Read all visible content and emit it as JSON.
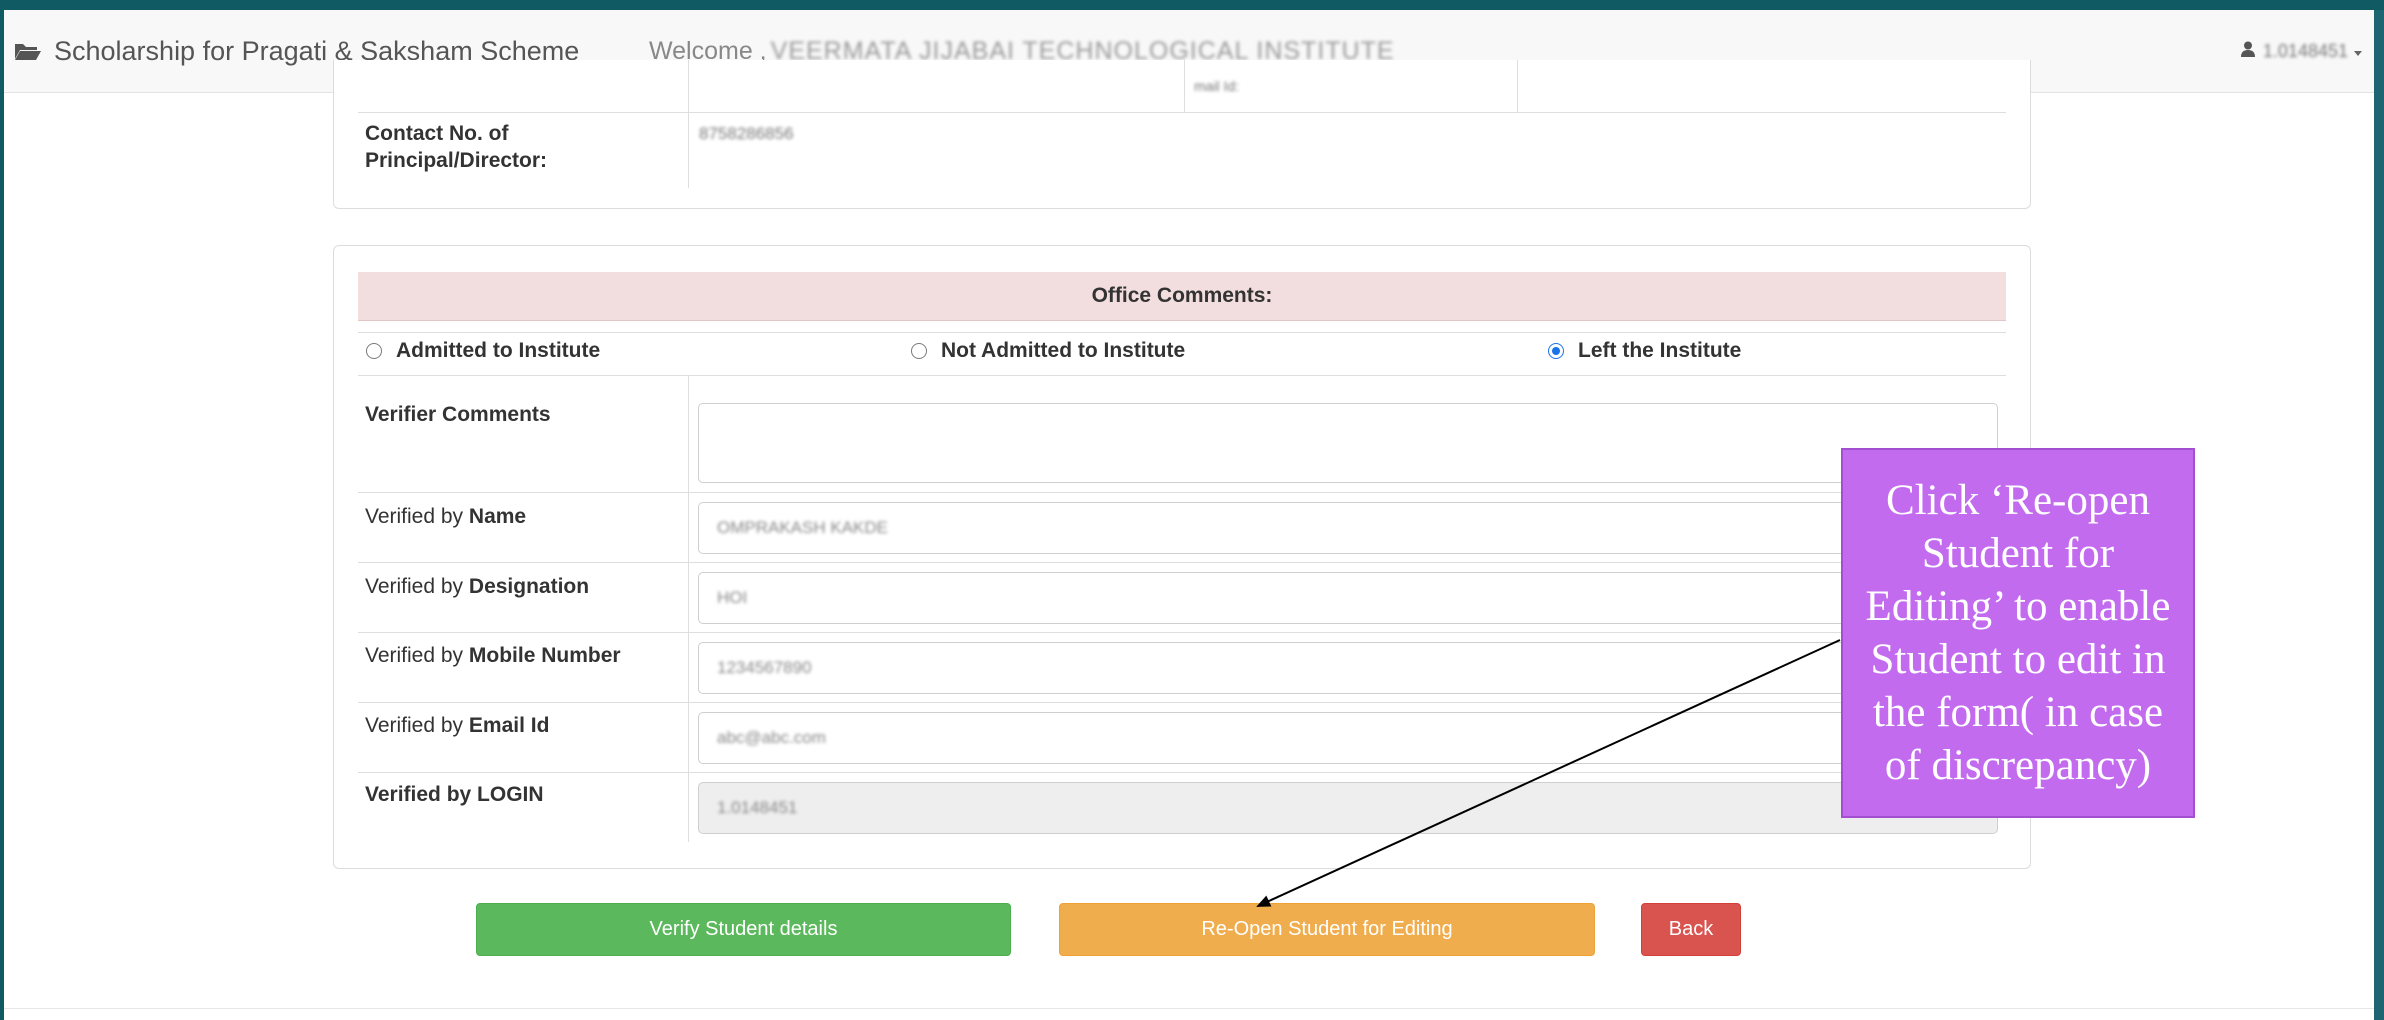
{
  "header": {
    "brand_title": "Scholarship for Pragati & Saksham Scheme",
    "welcome_prefix": "Welcome ,",
    "institute_name": "VEERMATA JIJABAI TECHNOLOGICAL INSTITUTE",
    "user_id": "1.0148451",
    "user_icon": "user-icon",
    "caret_icon": "caret-down-icon",
    "brand_icon": "folder-open-icon"
  },
  "institute_panel": {
    "principal_contact_label": "Contact No. of Principal/Director:",
    "principal_contact_value": "8758286856",
    "partial_cut_text": "mail Id:"
  },
  "office_comments": {
    "title": "Office Comments:",
    "options": [
      {
        "label": "Admitted to Institute",
        "selected": false
      },
      {
        "label": "Not Admitted to Institute",
        "selected": false
      },
      {
        "label": "Left the Institute",
        "selected": true
      }
    ],
    "fields": {
      "verifier_comments": {
        "label": "Verifier Comments",
        "value": ""
      },
      "name": {
        "label_prefix": "Verified by ",
        "label_strong": "Name",
        "value": "OMPRAKASH KAKDE"
      },
      "designation": {
        "label_prefix": "Verified by ",
        "label_strong": "Designation",
        "value": "HOI"
      },
      "mobile": {
        "label_prefix": "Verified by ",
        "label_strong": "Mobile Number",
        "value": "1234567890"
      },
      "email": {
        "label_prefix": "Verified by ",
        "label_strong": "Email Id",
        "value": "abc@abc.com"
      },
      "login": {
        "label": "Verified by LOGIN",
        "value": "1.0148451"
      }
    }
  },
  "actions": {
    "verify_label": "Verify Student details",
    "reopen_label": "Re-Open Student for Editing",
    "back_label": "Back"
  },
  "callout": {
    "text": "Click ‘Re-open Student for Editing’ to enable Student to edit in the form( in case of discrepancy)",
    "color": "#c36bee"
  },
  "colors": {
    "frame_teal": "#0f5a63",
    "header_bg": "#f2dede",
    "verify_green": "#5cb85c",
    "reopen_orange": "#f0ad4e",
    "back_red": "#d9534f"
  }
}
